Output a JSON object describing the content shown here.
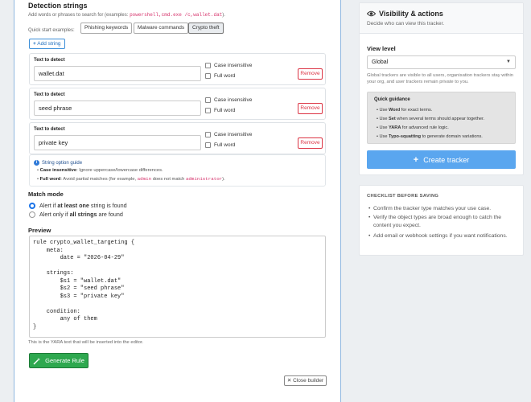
{
  "builder": {
    "title": "Detection strings",
    "hint_prefix": "Add words or phrases to search for (examples: ",
    "hint_code": "powershell,cmd.exe /c,wallet.dat",
    "hint_suffix": ").",
    "quick_start_label": "Quick start examples:",
    "quick_start": [
      "Phishing keywords",
      "Malware commands",
      "Crypto theft"
    ],
    "add_string": "Add string",
    "rows": [
      {
        "label": "Text to detect",
        "value": "wallet.dat",
        "case": "Case insensitive",
        "full": "Full word",
        "remove": "Remove"
      },
      {
        "label": "Text to detect",
        "value": "seed phrase",
        "case": "Case insensitive",
        "full": "Full word",
        "remove": "Remove"
      },
      {
        "label": "Text to detect",
        "value": "private key",
        "case": "Case insensitive",
        "full": "Full word",
        "remove": "Remove"
      }
    ],
    "guide": {
      "title": "String option guide",
      "ci_term": "Case insensitive",
      "ci_text": ": Ignore uppercase/lowercase differences.",
      "fw_term": "Full word",
      "fw_text_a": ": Avoid partial matches (for example, ",
      "fw_code_a": "admin",
      "fw_text_b": " does not match ",
      "fw_code_b": "administrator",
      "fw_text_c": ")."
    },
    "match_mode_title": "Match mode",
    "match_mode": {
      "opt1_a": "Alert if ",
      "opt1_b": "at least one",
      "opt1_c": " string is found",
      "opt2_a": "Alert only if ",
      "opt2_b": "all strings",
      "opt2_c": " are found"
    },
    "preview_title": "Preview",
    "preview_text": "rule crypto_wallet_targeting {\n    meta:\n        date = \"2026-04-29\"\n\n    strings:\n        $s1 = \"wallet.dat\"\n        $s2 = \"seed phrase\"\n        $s3 = \"private key\"\n\n    condition:\n        any of them\n}",
    "editor_note": "This is the YARA text that will be inserted into the editor.",
    "generate": "Generate Rule",
    "close": "Close builder"
  },
  "visibility": {
    "title": "Visibility & actions",
    "subtitle": "Decide who can view this tracker.",
    "view_level_label": "View level",
    "view_level_value": "Global",
    "view_level_note": "Global trackers are visible to all users, organisation trackers stay within your org, and user trackers remain private to you.",
    "guidance_title": "Quick guidance",
    "guidance": [
      {
        "a": "Use ",
        "b": "Word",
        "c": " for exact terms."
      },
      {
        "a": "Use ",
        "b": "Set",
        "c": " when several terms should appear together."
      },
      {
        "a": "Use ",
        "b": "YARA",
        "c": " for advanced rule logic."
      },
      {
        "a": "Use ",
        "b": "Typo-squatting",
        "c": " to generate domain variations."
      }
    ],
    "create": "Create tracker"
  },
  "checklist": {
    "title": "CHECKLIST BEFORE SAVING",
    "items": [
      "Confirm the tracker type matches your use case.",
      "Verify the object types are broad enough to catch the content you expect.",
      "Add email or webhook settings if you want notifications."
    ]
  }
}
